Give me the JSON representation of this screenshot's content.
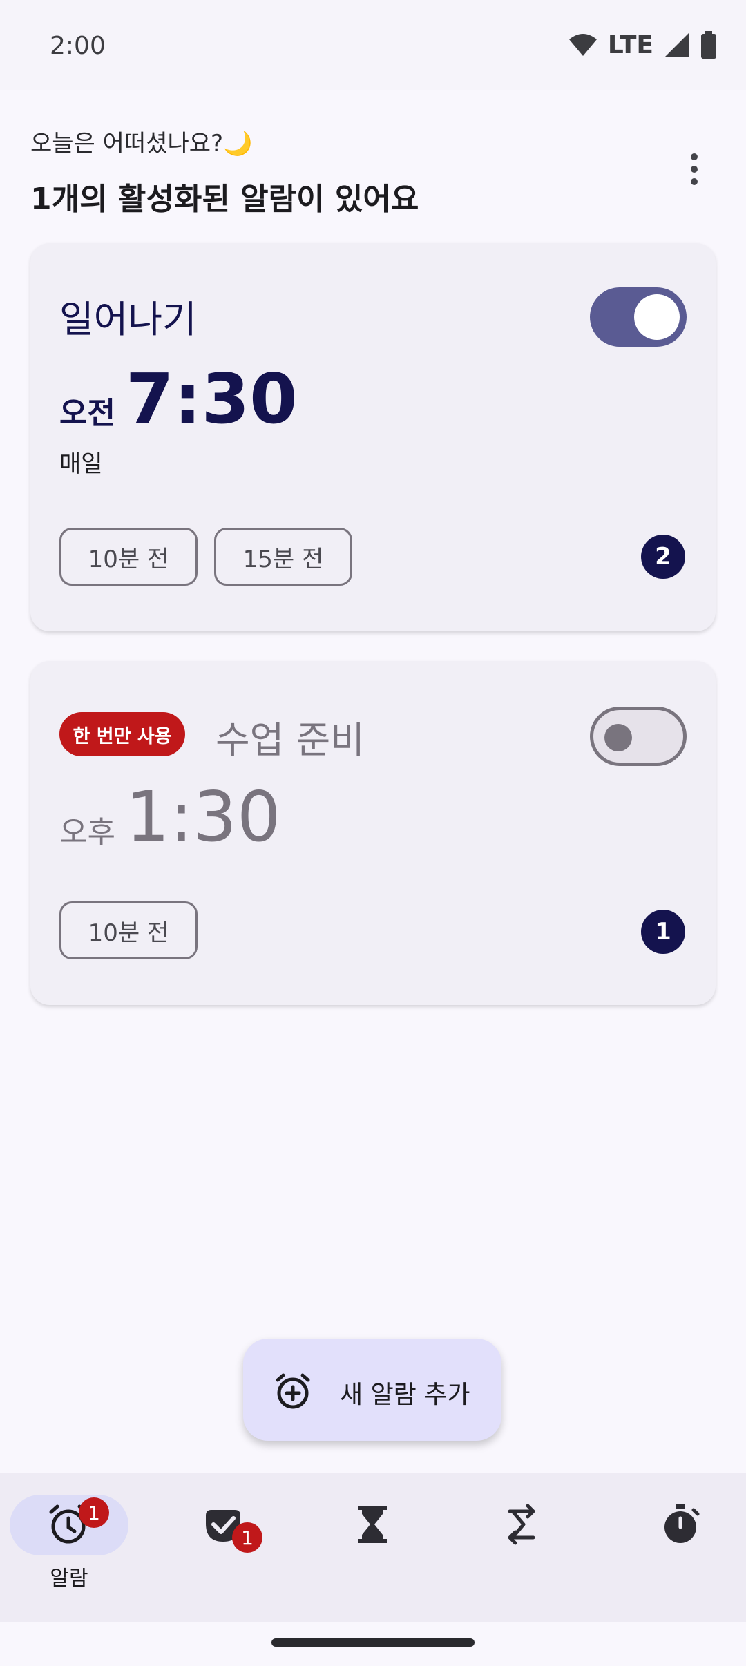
{
  "status_bar": {
    "time": "2:00",
    "network": "LTE"
  },
  "header": {
    "greeting": "오늘은 어떠셨나요?🌙",
    "summary": "1개의 활성화된 알람이 있어요"
  },
  "alarms": [
    {
      "label": "일어나기",
      "ampm": "오전",
      "time": "7:30",
      "repeat": "매일",
      "enabled": true,
      "reminders": [
        "10분 전",
        "15분 전"
      ],
      "reminder_count": "2"
    },
    {
      "badge": "한 번만 사용",
      "label": "수업 준비",
      "ampm": "오후",
      "time": "1:30",
      "enabled": false,
      "reminders": [
        "10분 전"
      ],
      "reminder_count": "1"
    }
  ],
  "fab": {
    "label": "새 알람 추가",
    "icon": "alarm-add-icon"
  },
  "bottom_nav": {
    "items": [
      {
        "icon": "alarm-icon",
        "label": "알람",
        "badge": "1",
        "selected": true
      },
      {
        "icon": "task-check-icon",
        "badge": "1"
      },
      {
        "icon": "hourglass-timer-icon"
      },
      {
        "icon": "routine-icon"
      },
      {
        "icon": "stopwatch-icon"
      }
    ]
  },
  "colors": {
    "accent": "#5a5b93",
    "badge_red": "#c0181a",
    "badge_navy": "#14134e",
    "fab_bg": "#e2e0fb"
  }
}
